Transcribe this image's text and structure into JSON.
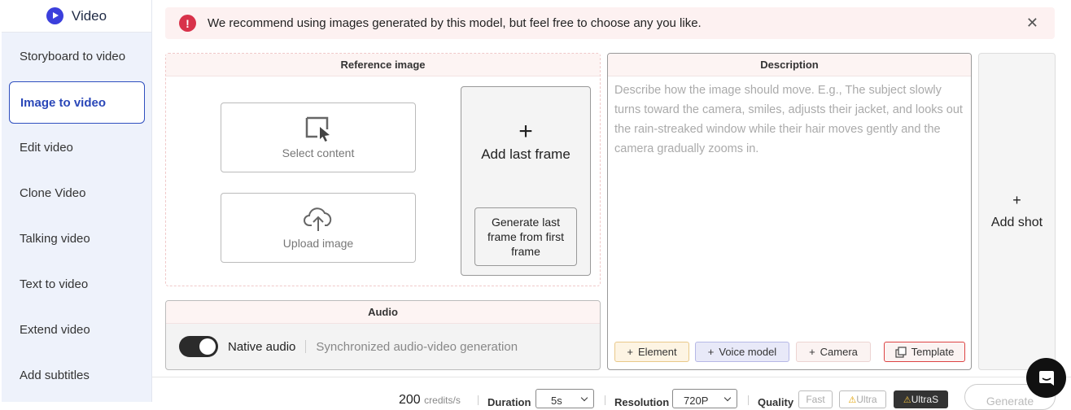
{
  "sidebar": {
    "title": "Video",
    "items": [
      {
        "label": "Storyboard to video",
        "active": false
      },
      {
        "label": "Image to video",
        "active": true
      },
      {
        "label": "Edit video",
        "active": false
      },
      {
        "label": "Clone Video",
        "active": false
      },
      {
        "label": "Talking video",
        "active": false
      },
      {
        "label": "Text to video",
        "active": false
      },
      {
        "label": "Extend video",
        "active": false
      },
      {
        "label": "Add subtitles",
        "active": false
      }
    ]
  },
  "alert": {
    "icon": "exclamation-icon",
    "text": "We recommend using images generated by this model, but feel free to choose any you like."
  },
  "reference": {
    "title": "Reference image",
    "select_content": "Select content",
    "upload_image": "Upload image",
    "add_last_frame": "Add last frame",
    "generate_last_frame": "Generate last frame from first frame"
  },
  "audio": {
    "title": "Audio",
    "toggle_label": "Native audio",
    "toggle_on": true,
    "description": "Synchronized audio-video generation"
  },
  "description": {
    "title": "Description",
    "placeholder": "Describe how the image should move. E.g., The subject slowly turns toward the camera, smiles, adjusts their jacket, and looks out the rain-streaked window while their hair moves gently and the camera gradually zooms in.",
    "chips": {
      "element": "Element",
      "voice_model": "Voice model",
      "camera": "Camera",
      "template": "Template"
    }
  },
  "add_shot": {
    "label": "Add shot"
  },
  "bottom": {
    "credits_value": "200",
    "credits_unit": "credits/s",
    "duration_label": "Duration",
    "duration_value": "5s",
    "resolution_label": "Resolution",
    "resolution_value": "720P",
    "quality_label": "Quality",
    "quality_options": [
      "Fast",
      "Ultra",
      "UltraS"
    ],
    "generate_label": "Generate"
  },
  "colors": {
    "accent": "#2a47b8",
    "alert_bg": "#fdf1f1",
    "alert_icon": "#d8324a"
  }
}
